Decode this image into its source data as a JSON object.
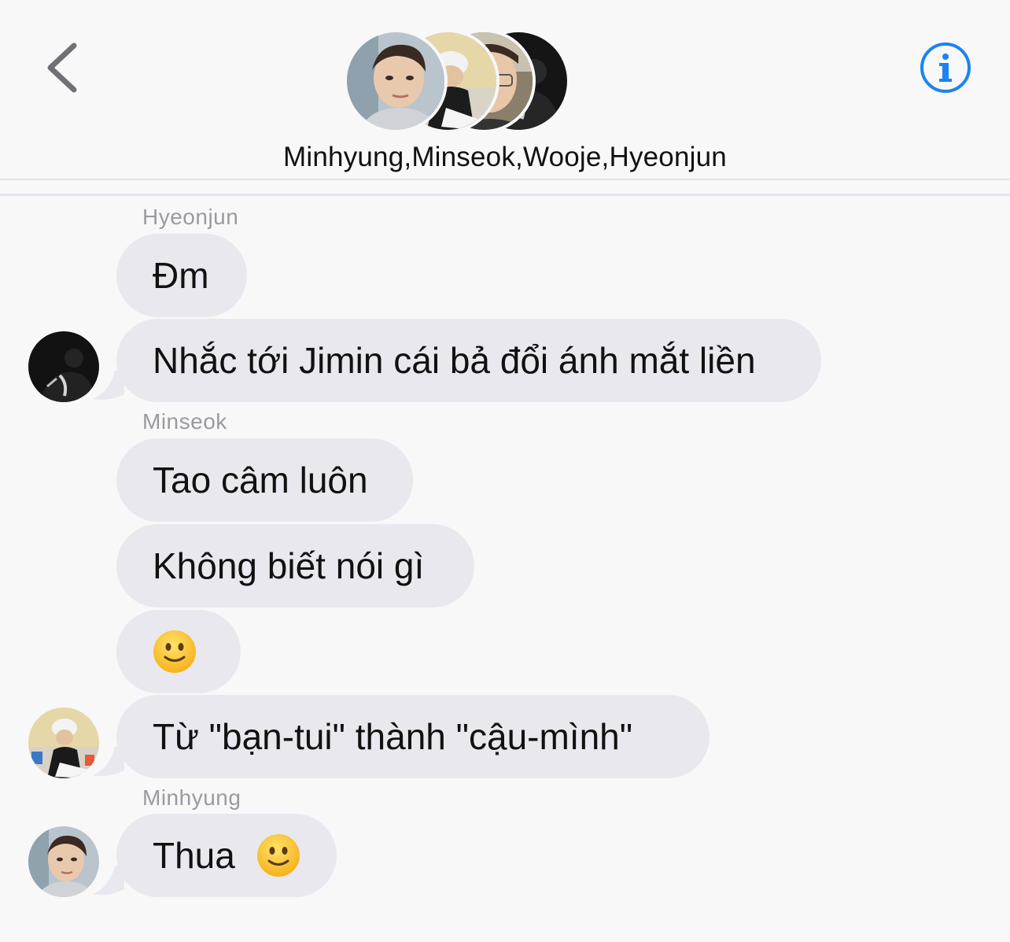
{
  "header": {
    "title": "Minhyung,Minseok,Wooje,Hyeonjun",
    "back_icon": "chevron-left-icon",
    "info_icon": "info-icon",
    "accent_color": "#1a84f0"
  },
  "messages": [
    {
      "sender": "Hyeonjun",
      "text": "Đm"
    },
    {
      "sender": "Hyeonjun",
      "text": "Nhắc tới Jimin cái bả đổi ánh mắt liền"
    },
    {
      "sender": "Minseok",
      "text": "Tao câm luôn"
    },
    {
      "sender": "Minseok",
      "text": "Không biết nói gì"
    },
    {
      "sender": "Minseok",
      "emoji": "slightly-smiling-face-emoji"
    },
    {
      "sender": "Minseok",
      "text": "Từ \"bạn-tui\" thành \"cậu-mình\""
    },
    {
      "sender": "Minhyung",
      "text": "Thua"
    }
  ],
  "sender_labels": {
    "hyeonjun": "Hyeonjun",
    "minseok": "Minseok",
    "minhyung": "Minhyung"
  },
  "colors": {
    "background": "#f8f8f9",
    "bubble": "#e9e8ef",
    "sender_label": "#9a9a9f"
  }
}
